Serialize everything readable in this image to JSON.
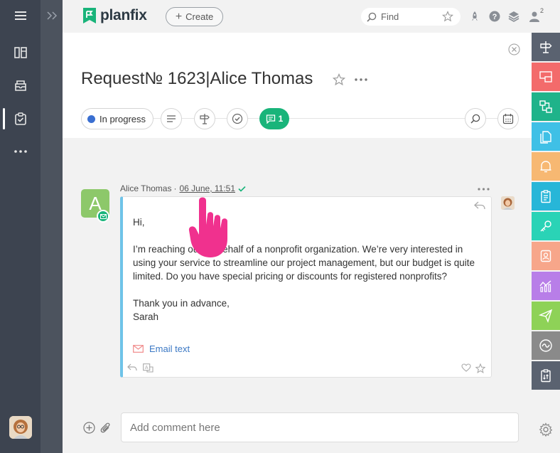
{
  "app": {
    "brand": "planfix"
  },
  "topbar": {
    "create_label": "Create",
    "search_placeholder": "Find",
    "notifications_count": "2"
  },
  "task": {
    "title": "Request№ 1623|Alice Thomas",
    "status": "In progress",
    "comments_count": "1"
  },
  "message": {
    "author": "Alice Thomas",
    "date": "06 June, 11:51",
    "greeting": "Hi,",
    "body": "I’m reaching out on behalf of a nonprofit organization. We’re very interested in using your service to streamline our project management, but our budget is quite limited. Do you have special pricing or discounts for registered nonprofits?",
    "closing_1": "Thank you in advance,",
    "closing_2": "Sarah",
    "email_link": "Email text",
    "avatar_letter": "A"
  },
  "comment": {
    "placeholder": "Add comment here"
  },
  "colors": {
    "left_rail": "#3d4450",
    "accent_green": "#19b47a",
    "status_blue": "#3a6fd1",
    "message_border": "#6fc3e8",
    "pointer_pink": "#f0318e"
  },
  "rightbar_items": [
    {
      "icon": "task-icon",
      "color": "#5a6270"
    },
    {
      "icon": "screen-icon",
      "color": "#f36b6b"
    },
    {
      "icon": "flow-icon",
      "color": "#1fb38a"
    },
    {
      "icon": "documents-icon",
      "color": "#3fc0e6"
    },
    {
      "icon": "bell-icon",
      "color": "#f7b872"
    },
    {
      "icon": "clipboard-icon",
      "color": "#27b6d8"
    },
    {
      "icon": "key-icon",
      "color": "#2ad3b6"
    },
    {
      "icon": "contact-icon",
      "color": "#f7a68a"
    },
    {
      "icon": "analytics-icon",
      "color": "#b87ee8"
    },
    {
      "icon": "send-icon",
      "color": "#8ed257"
    },
    {
      "icon": "wave-icon",
      "color": "#8a8a8a"
    },
    {
      "icon": "report-icon",
      "color": "#5a6270"
    }
  ]
}
